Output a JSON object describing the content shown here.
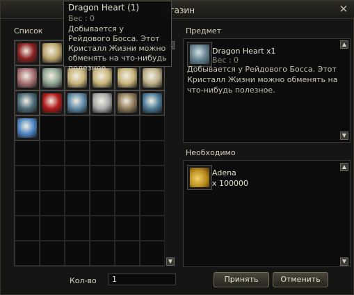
{
  "window": {
    "title": "агазин"
  },
  "tooltip": {
    "name": "Dragon Heart (1)",
    "weight": "Вес :  0",
    "description": "Добывается у Рейдового Босса. Этот Кристалл Жизни можно обменять на что-нибудь полезное."
  },
  "list": {
    "label": "Список",
    "items": [
      {
        "icon": "red-scrolls-icon",
        "color": "#8a1f1f"
      },
      {
        "icon": "map-scroll-icon",
        "color": "#b9a46a"
      },
      {
        "icon": "crystal-orb-gold-icon",
        "color": "#9d9a8c"
      },
      {
        "icon": "crystal-orb-blue-icon",
        "color": "#6e7fb0"
      },
      {
        "icon": "dragon-heart-icon",
        "color": "#6f8b96"
      },
      {
        "icon": "crystal-orb-silver-icon",
        "color": "#9ea2a6"
      },
      {
        "icon": "crystal-orb-red-icon",
        "color": "#a76f72"
      },
      {
        "icon": "crystal-orb-green-icon",
        "color": "#8fa592"
      },
      {
        "icon": "scroll-red-seal-icon",
        "color": "#c7b47a"
      },
      {
        "icon": "scroll-red-flower-icon",
        "color": "#c7b47a"
      },
      {
        "icon": "scroll-red-ribbon-icon",
        "color": "#c7b47a"
      },
      {
        "icon": "scroll-blue-mark-icon",
        "color": "#bcae85"
      },
      {
        "icon": "claw-icon",
        "color": "#4c6c78"
      },
      {
        "icon": "red-cloak-icon",
        "color": "#b11a1a"
      },
      {
        "icon": "ice-scroll-icon",
        "color": "#5e8aa8"
      },
      {
        "icon": "silver-shard-icon",
        "color": "#a9a9a9"
      },
      {
        "icon": "rolled-scroll-icon",
        "color": "#8f7a58"
      },
      {
        "icon": "blue-ore-icon",
        "color": "#4b7c9a"
      },
      {
        "icon": "blue-crystals-icon",
        "color": "#4d86c4"
      }
    ],
    "selected_index": 4
  },
  "item_panel": {
    "label": "Предмет",
    "name": "Dragon Heart x1",
    "weight": "Вес :  0",
    "description": "Добывается у Рейдового Босса. Этот Кристалл Жизни можно обменять на что-нибудь полезное."
  },
  "requirements": {
    "label": "Необходимо",
    "name": "Adena",
    "amount": "x 100000"
  },
  "quantity": {
    "label": "Кол-во",
    "value": "1"
  },
  "buttons": {
    "accept": "Принять",
    "cancel": "Отменить"
  },
  "colors": {
    "window_bg": "#151515",
    "panel_bg": "#0c0c0c",
    "text": "#c9c4b4",
    "selection": "#6b8fa0"
  }
}
